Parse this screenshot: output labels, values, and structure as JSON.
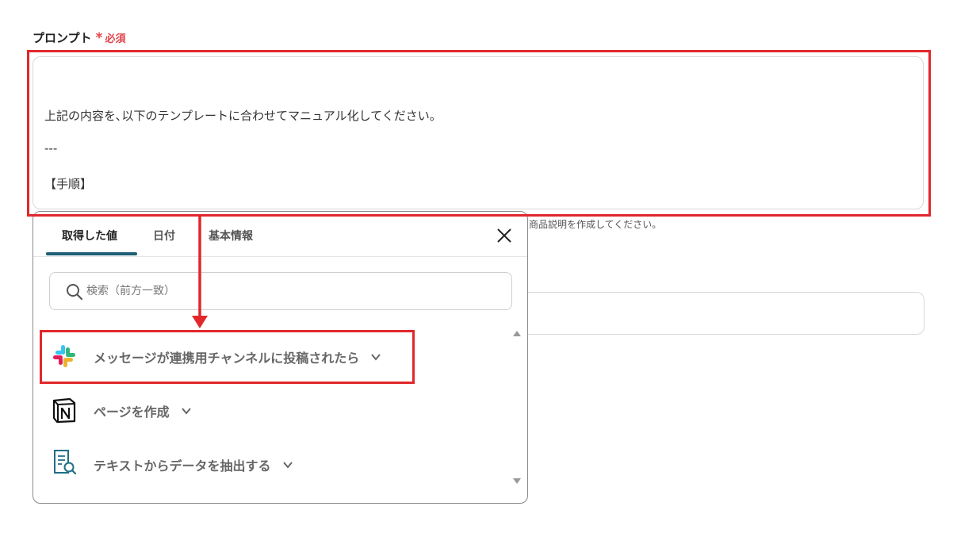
{
  "field": {
    "label": "プロンプト",
    "required_mark": "*",
    "required_text": "必須"
  },
  "prompt": {
    "lines": [
      "上記の内容を､以下のテンプレートに合わせてマニュアル化してください。",
      "---",
      "【手順】"
    ]
  },
  "hint_text": "の商品説明を作成してください。",
  "popup": {
    "tabs": [
      {
        "label": "取得した値",
        "active": true
      },
      {
        "label": "日付",
        "active": false
      },
      {
        "label": "基本情報",
        "active": false
      }
    ],
    "search": {
      "placeholder": "検索（前方一致）",
      "value": ""
    },
    "items": [
      {
        "label": "メッセージが連携用チャンネルに投稿されたら",
        "icon": "slack-icon"
      },
      {
        "label": "ページを作成",
        "icon": "notion-icon"
      },
      {
        "label": "テキストからデータを抽出する",
        "icon": "document-search-icon"
      }
    ]
  },
  "colors": {
    "highlight": "#e1272a",
    "required": "#e2454b",
    "tab_underline": "#1c5e75"
  }
}
